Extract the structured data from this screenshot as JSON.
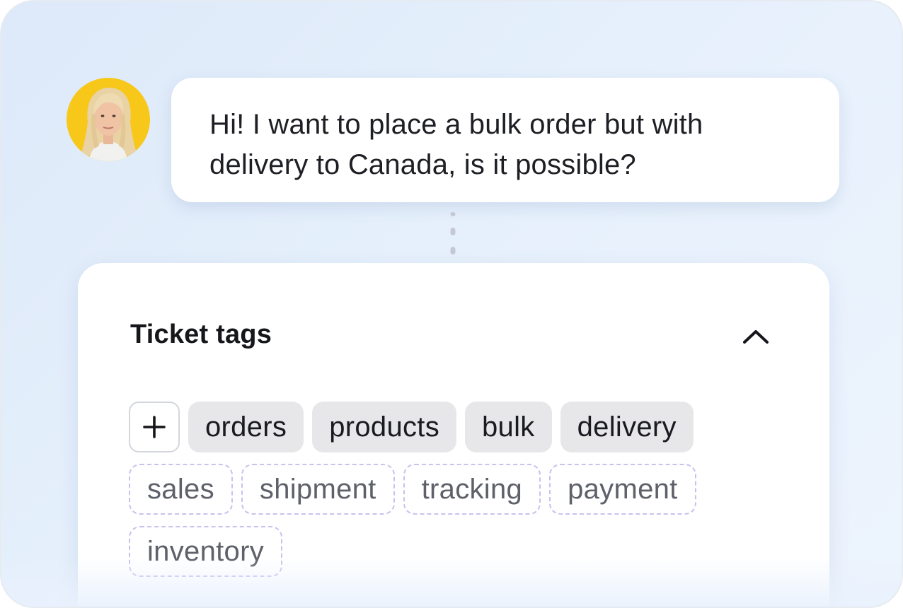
{
  "chat": {
    "message": "Hi! I want to place a bulk order but with delivery to Canada, is it possible?"
  },
  "ticket_tags": {
    "title": "Ticket tags",
    "collapse_icon": "chevron-up-icon",
    "add_icon": "plus-icon",
    "selected_tags": [
      "orders",
      "products",
      "bulk",
      "delivery"
    ],
    "suggested_tags": [
      "sales",
      "shipment",
      "tracking",
      "payment",
      "inventory"
    ]
  },
  "colors": {
    "avatar_background": "#f7c71a",
    "selected_tag_bg": "#e7e7e9",
    "suggested_tag_border": "#c6c3ee"
  }
}
